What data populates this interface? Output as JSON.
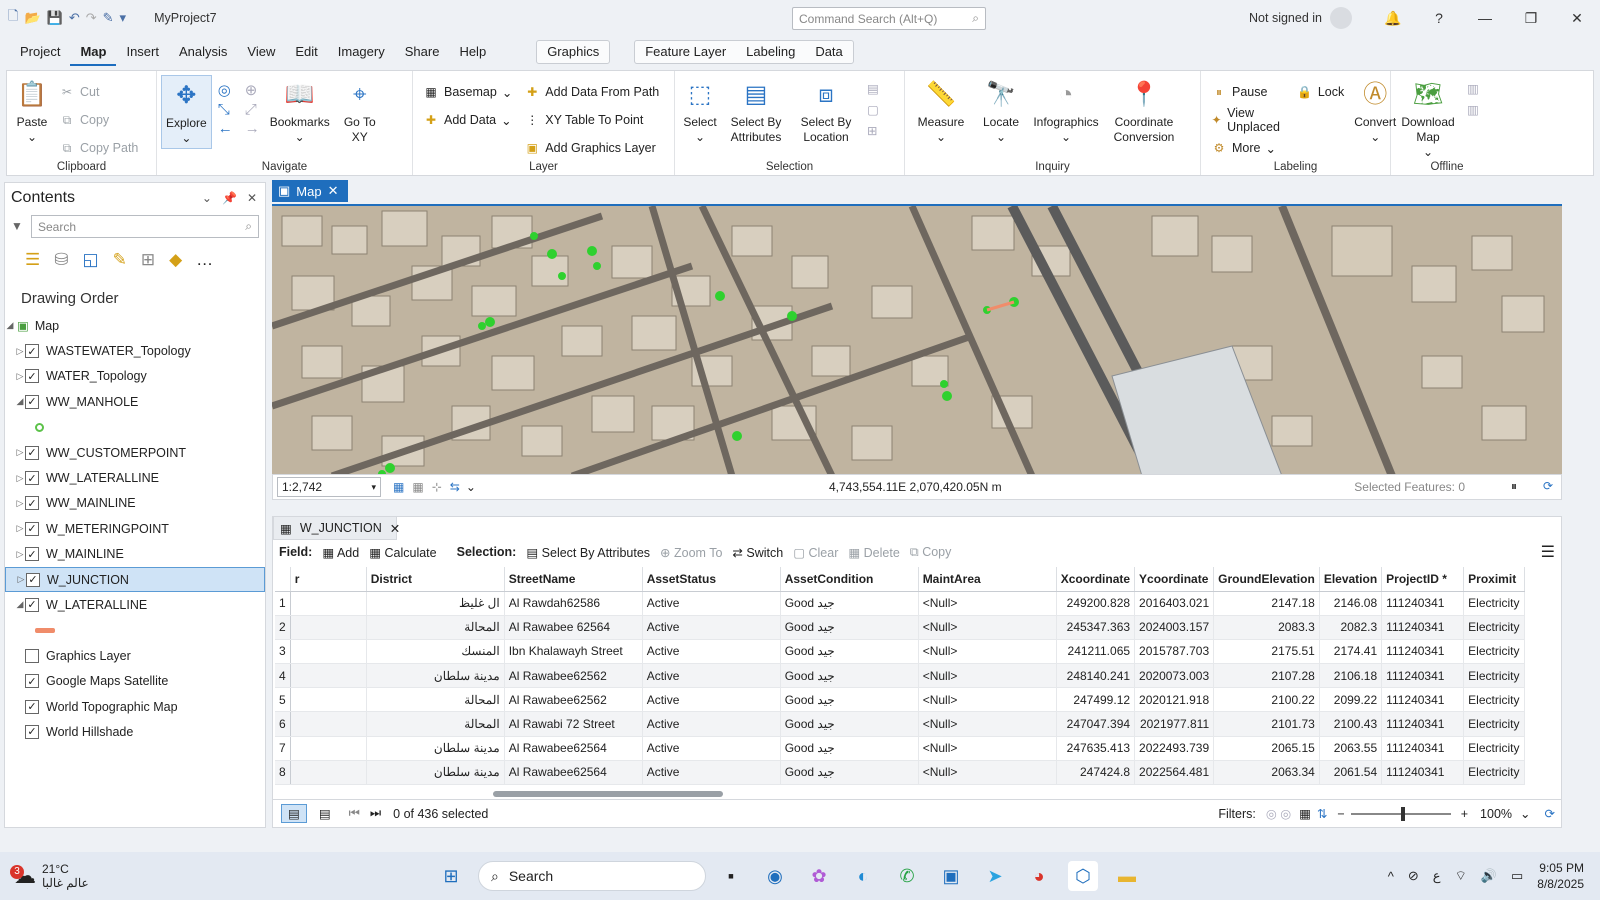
{
  "window": {
    "title": "MyProject7",
    "command_search": "Command Search (Alt+Q)",
    "user": "Not signed in"
  },
  "ribbon_tabs": [
    "Project",
    "Map",
    "Insert",
    "Analysis",
    "View",
    "Edit",
    "Imagery",
    "Share",
    "Help"
  ],
  "active_tab": "Map",
  "context_tabs": {
    "graphics": "Graphics",
    "feature": [
      "Feature Layer",
      "Labeling",
      "Data"
    ]
  },
  "ribbon": {
    "clipboard": {
      "label": "Clipboard",
      "paste": "Paste",
      "cut": "Cut",
      "copy": "Copy",
      "copy_path": "Copy Path"
    },
    "navigate": {
      "label": "Navigate",
      "explore": "Explore",
      "bookmarks": "Bookmarks",
      "goto": "Go To XY"
    },
    "layer": {
      "label": "Layer",
      "basemap": "Basemap",
      "add_data": "Add Data",
      "add_path": "Add Data From Path",
      "xy": "XY Table To Point",
      "add_graphics": "Add Graphics Layer"
    },
    "selection": {
      "label": "Selection",
      "select": "Select",
      "by_attr": "Select By Attributes",
      "by_loc": "Select By Location"
    },
    "inquiry": {
      "label": "Inquiry",
      "measure": "Measure",
      "locate": "Locate",
      "infographics": "Infographics",
      "coord_conv": "Coordinate Conversion"
    },
    "labeling": {
      "label": "Labeling",
      "pause": "Pause",
      "lock": "Lock",
      "view_unplaced": "View Unplaced",
      "more": "More",
      "convert": "Convert"
    },
    "offline": {
      "label": "Offline",
      "download": "Download Map"
    }
  },
  "contents": {
    "title": "Contents",
    "search_placeholder": "Search",
    "drawing_order": "Drawing Order",
    "root": "Map",
    "layers": [
      {
        "name": "WASTEWATER_Topology",
        "checked": true,
        "exp": "collapsed"
      },
      {
        "name": "WATER_Topology",
        "checked": true,
        "exp": "collapsed"
      },
      {
        "name": "WW_MANHOLE",
        "checked": true,
        "exp": "expanded",
        "symbol": "dot"
      },
      {
        "name": "WW_CUSTOMERPOINT",
        "checked": true,
        "exp": "collapsed"
      },
      {
        "name": "WW_LATERALLINE",
        "checked": true,
        "exp": "collapsed"
      },
      {
        "name": "WW_MAINLINE",
        "checked": true,
        "exp": "collapsed"
      },
      {
        "name": "W_METERINGPOINT",
        "checked": true,
        "exp": "collapsed"
      },
      {
        "name": "W_MAINLINE",
        "checked": true,
        "exp": "collapsed"
      },
      {
        "name": "W_JUNCTION",
        "checked": true,
        "exp": "collapsed",
        "selected": true
      },
      {
        "name": "W_LATERALLINE",
        "checked": true,
        "exp": "expanded",
        "symbol": "line"
      },
      {
        "name": "Graphics Layer",
        "checked": false,
        "exp": "none"
      },
      {
        "name": "Google Maps Satellite",
        "checked": true,
        "exp": "none"
      },
      {
        "name": "World Topographic Map",
        "checked": true,
        "exp": "none"
      },
      {
        "name": "World Hillshade",
        "checked": true,
        "exp": "none"
      }
    ]
  },
  "map": {
    "tab": "Map",
    "scale": "1:2,742",
    "coordinates": "4,743,554.11E 2,070,420.05N m",
    "selected_features": "Selected Features: 0"
  },
  "attribute_table": {
    "tab": "W_JUNCTION",
    "toolbar": {
      "field": "Field:",
      "add": "Add",
      "calculate": "Calculate",
      "selection": "Selection:",
      "select_by_attr": "Select By Attributes",
      "zoom_to": "Zoom To",
      "switch": "Switch",
      "clear": "Clear",
      "delete": "Delete",
      "copy": "Copy"
    },
    "columns": [
      "r",
      "District",
      "StreetName",
      "AssetStatus",
      "AssetCondition",
      "MaintArea",
      "Xcoordinate",
      "Ycoordinate",
      "GroundElevation",
      "Elevation",
      "ProjectID *",
      "Proximit"
    ],
    "rows": [
      [
        "1",
        "",
        "ال غليظ",
        "Al Rawdah62586",
        "Active",
        "Good جيد",
        "<Null>",
        "249200.828",
        "2016403.021",
        "2147.18",
        "2146.08",
        "111240341",
        "Electricity"
      ],
      [
        "2",
        "",
        "المحالة",
        "Al Rawabee 62564",
        "Active",
        "Good جيد",
        "<Null>",
        "245347.363",
        "2024003.157",
        "2083.3",
        "2082.3",
        "111240341",
        "Electricity"
      ],
      [
        "3",
        "",
        "المنسك",
        "Ibn Khalawayh Street",
        "Active",
        "Good جيد",
        "<Null>",
        "241211.065",
        "2015787.703",
        "2175.51",
        "2174.41",
        "111240341",
        "Electricity"
      ],
      [
        "4",
        "",
        "مدينة سلطان",
        "Al Rawabee62562",
        "Active",
        "Good جيد",
        "<Null>",
        "248140.241",
        "2020073.003",
        "2107.28",
        "2106.18",
        "111240341",
        "Electricity"
      ],
      [
        "5",
        "",
        "المحالة",
        "Al Rawabee62562",
        "Active",
        "Good جيد",
        "<Null>",
        "247499.12",
        "2020121.918",
        "2100.22",
        "2099.22",
        "111240341",
        "Electricity"
      ],
      [
        "6",
        "",
        "المحالة",
        "Al Rawabi 72 Street",
        "Active",
        "Good جيد",
        "<Null>",
        "247047.394",
        "2021977.811",
        "2101.73",
        "2100.43",
        "111240341",
        "Electricity"
      ],
      [
        "7",
        "",
        "مدينة سلطان",
        "Al Rawabee62564",
        "Active",
        "Good جيد",
        "<Null>",
        "247635.413",
        "2022493.739",
        "2065.15",
        "2063.55",
        "111240341",
        "Electricity"
      ],
      [
        "8",
        "",
        "مدينة سلطان",
        "Al Rawabee62564",
        "Active",
        "Good جيد",
        "<Null>",
        "247424.8",
        "2022564.481",
        "2063.34",
        "2061.54",
        "111240341",
        "Electricity"
      ]
    ],
    "status": "0 of 436 selected",
    "filters": "Filters:",
    "zoom": "100%"
  },
  "taskbar": {
    "temp": "21°C",
    "weather": "عالم غالبا",
    "badge": "3",
    "search": "Search",
    "time": "9:05 PM",
    "date": "8/8/2025",
    "lang": "ع"
  },
  "colors": {
    "accent": "#1f6ebd",
    "selected": "#cfe3f6",
    "manhole": "#2fd12f",
    "lateral": "#f08c6a"
  }
}
